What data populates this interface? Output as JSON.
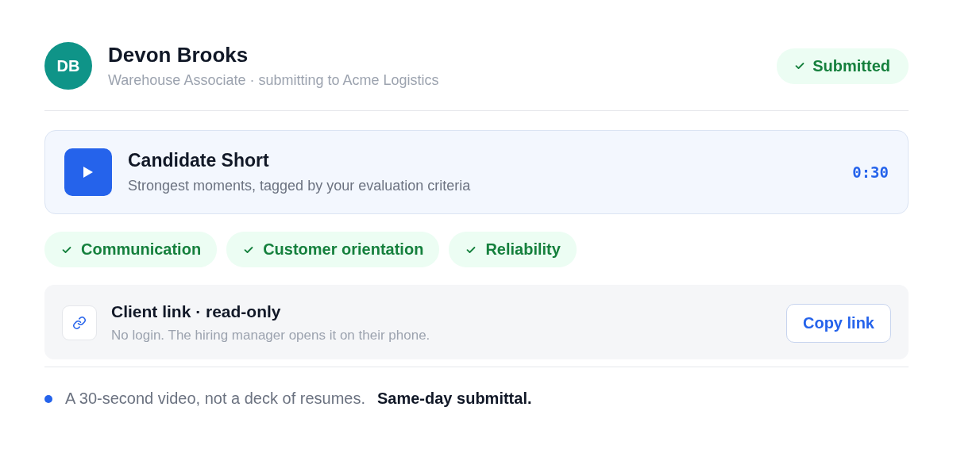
{
  "candidate": {
    "initials": "DB",
    "name": "Devon Brooks",
    "subtitle": "Warehouse Associate · submitting to Acme Logistics",
    "status": "Submitted"
  },
  "video": {
    "title": "Candidate Short",
    "description": "Strongest moments, tagged by your evaluation criteria",
    "duration": "0:30"
  },
  "tags": [
    "Communication",
    "Customer orientation",
    "Reliability"
  ],
  "client_link": {
    "title": "Client link · read-only",
    "description": "No login. The hiring manager opens it on their phone.",
    "button": "Copy link"
  },
  "footer": {
    "note": "A 30-second video, not a deck of resumes.",
    "highlight": "Same-day submittal."
  }
}
